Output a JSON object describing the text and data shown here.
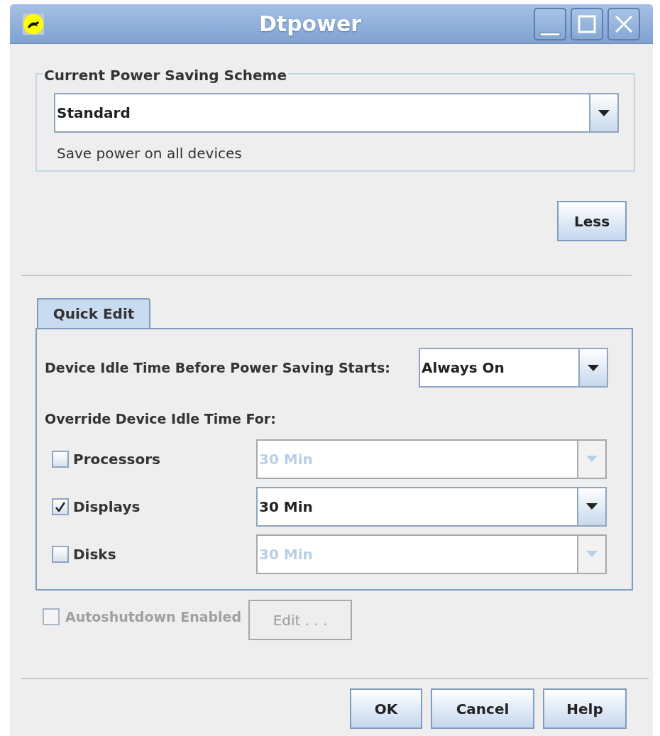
{
  "window": {
    "title": "Dtpower"
  },
  "scheme_group": {
    "title": "Current Power Saving Scheme",
    "scheme": "Standard",
    "description": "Save power on all devices"
  },
  "less_button": "Less",
  "tabs": [
    {
      "label": "Quick Edit",
      "selected": true
    }
  ],
  "idle_time": {
    "label": "Device Idle Time Before Power Saving Starts:",
    "value": "Always On"
  },
  "override_label": "Override Device Idle Time For:",
  "devices": [
    {
      "name": "Processors",
      "checked": false,
      "value": "30 Min"
    },
    {
      "name": "Displays",
      "checked": true,
      "value": "30 Min"
    },
    {
      "name": "Disks",
      "checked": false,
      "value": "30 Min"
    }
  ],
  "autoshutdown": {
    "label": "Autoshutdown Enabled",
    "checked": false,
    "disabled": true,
    "edit_button": "Edit . . ."
  },
  "buttons": [
    "OK",
    "Cancel",
    "Help"
  ]
}
